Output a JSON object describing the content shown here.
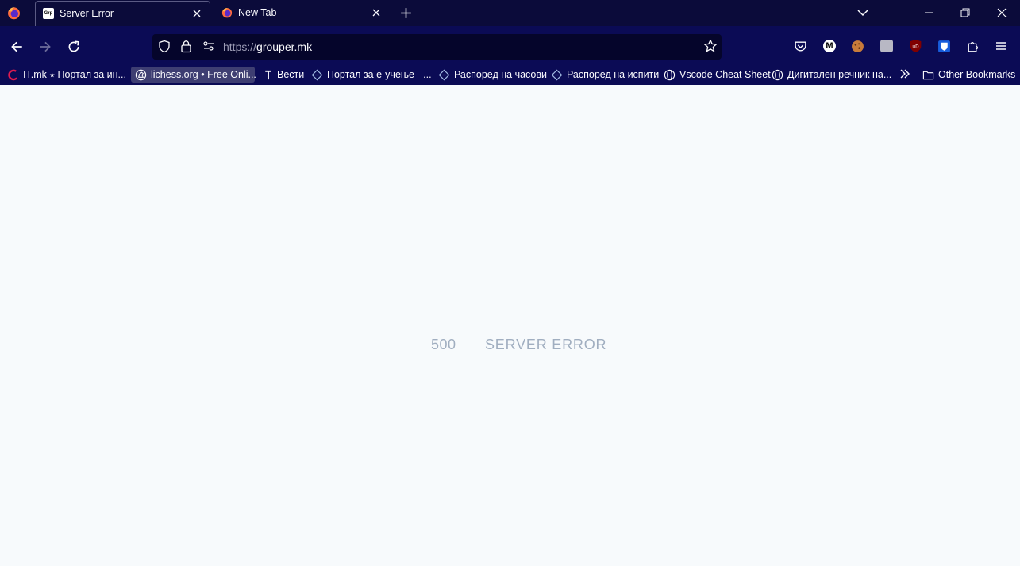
{
  "browser": {
    "tabs": [
      {
        "title": "Server Error",
        "favicon": "grp",
        "active": true
      },
      {
        "title": "New Tab",
        "favicon": "firefox-icon",
        "active": false
      }
    ],
    "url_scheme": "https://",
    "url_host": "grouper.mk",
    "extension_m_label": "M",
    "ublock_label": "uD"
  },
  "bookmarks": {
    "items": [
      {
        "label": "IT.mk ⭑ Портал за ин...",
        "icon": "itmk-icon"
      },
      {
        "label": "lichess.org • Free Onli...",
        "icon": "lichess-icon"
      },
      {
        "label": "Вести",
        "icon": "vesti-icon"
      },
      {
        "label": "Портал за е-учење - ...",
        "icon": "elearning-icon"
      },
      {
        "label": "Распоред на часови",
        "icon": "elearning-icon"
      },
      {
        "label": "Распоред на испити",
        "icon": "elearning-icon"
      },
      {
        "label": "Vscode Cheat Sheet",
        "icon": "globe-icon"
      },
      {
        "label": "Дигитален речник на...",
        "icon": "globe-icon"
      }
    ],
    "other_label": "Other Bookmarks"
  },
  "page": {
    "code": "500",
    "message": "Server Error"
  },
  "colors": {
    "titlebar": "#0b0b3a",
    "toolbar": "#0b0b55",
    "page_background": "#f7fafc",
    "error_text": "#a0aec0"
  }
}
